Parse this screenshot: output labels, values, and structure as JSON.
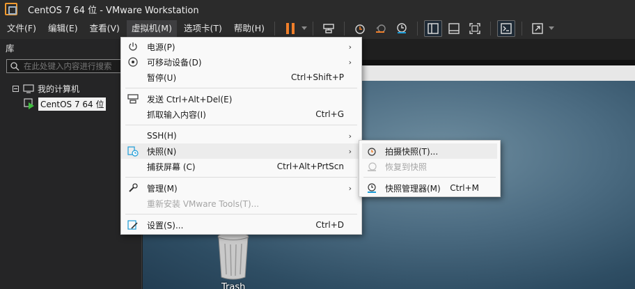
{
  "window": {
    "title": "CentOS 7 64 位 - VMware Workstation"
  },
  "menubar": {
    "items": [
      "文件(F)",
      "编辑(E)",
      "查看(V)",
      "虚拟机(M)",
      "选项卡(T)",
      "帮助(H)"
    ],
    "active_index": 3
  },
  "library": {
    "title": "库",
    "search_placeholder": "在此处键入内容进行搜索",
    "tree": {
      "root": "我的计算机",
      "vm": "CentOS 7 64 位"
    }
  },
  "vm_menu": {
    "power": {
      "label": "电源(P)"
    },
    "removable": {
      "label": "可移动设备(D)"
    },
    "pause": {
      "label": "暂停(U)",
      "shortcut": "Ctrl+Shift+P"
    },
    "send_cad": {
      "label": "发送 Ctrl+Alt+Del(E)"
    },
    "grab_input": {
      "label": "抓取输入内容(I)",
      "shortcut": "Ctrl+G"
    },
    "ssh": {
      "label": "SSH(H)"
    },
    "snapshot": {
      "label": "快照(N)"
    },
    "capture_screen": {
      "label": "捕获屏幕 (C)",
      "shortcut": "Ctrl+Alt+PrtScn"
    },
    "manage": {
      "label": "管理(M)"
    },
    "reinstall_tools": {
      "label": "重新安装 VMware Tools(T)..."
    },
    "settings": {
      "label": "设置(S)...",
      "shortcut": "Ctrl+D"
    }
  },
  "snapshot_submenu": {
    "take": {
      "label": "拍摄快照(T)..."
    },
    "revert": {
      "label": "恢复到快照"
    },
    "manager": {
      "label": "快照管理器(M)",
      "shortcut": "Ctrl+M"
    }
  },
  "desktop": {
    "trash_label": "Trash"
  },
  "colors": {
    "pause_accent": "#f07f2a",
    "menu_bg": "#f9f9f9",
    "chrome_bg": "#2b2b2b",
    "snapshot_teal": "#1a9bd7"
  }
}
